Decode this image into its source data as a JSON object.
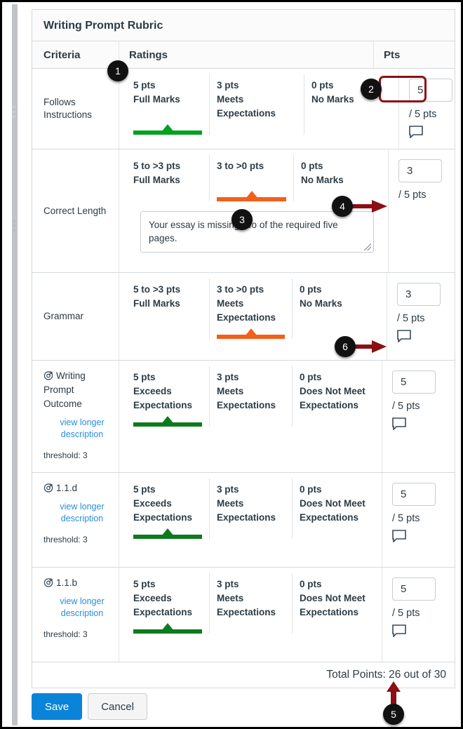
{
  "rubric": {
    "title": "Writing Prompt Rubric",
    "columns": {
      "criteria": "Criteria",
      "ratings": "Ratings",
      "pts": "Pts"
    },
    "rows": [
      {
        "criterion": "Follows Instructions",
        "is_outcome": false,
        "ratings": [
          {
            "pts": "5 pts",
            "desc": "Full Marks",
            "selected": true,
            "color": "#00A11F"
          },
          {
            "pts": "3 pts",
            "desc": "Meets Expectations",
            "selected": false
          },
          {
            "pts": "0 pts",
            "desc": "No Marks",
            "selected": false
          }
        ],
        "score": "5",
        "denominator": "/ 5 pts",
        "comment_icon": "comment-bubble-icon",
        "comment_text": null
      },
      {
        "criterion": "Correct Length",
        "is_outcome": false,
        "ratings": [
          {
            "pts": "5 to >3 pts",
            "desc": "Full Marks",
            "selected": false
          },
          {
            "pts": "3 to >0 pts",
            "desc": "",
            "selected": true,
            "color": "#F2601A"
          },
          {
            "pts": "0 pts",
            "desc": "No Marks",
            "selected": false
          }
        ],
        "score": "3",
        "denominator": "/ 5 pts",
        "comment_icon": null,
        "comment_text": "Your essay is missing two of the required five pages."
      },
      {
        "criterion": "Grammar",
        "is_outcome": false,
        "ratings": [
          {
            "pts": "5 to >3 pts",
            "desc": "Full Marks",
            "selected": false
          },
          {
            "pts": "3 to >0 pts",
            "desc": "Meets Expectations",
            "selected": true,
            "color": "#F2601A"
          },
          {
            "pts": "0 pts",
            "desc": "No Marks",
            "selected": false
          }
        ],
        "score": "3",
        "denominator": "/ 5 pts",
        "comment_icon": "comment-bubble-icon",
        "comment_text": null
      },
      {
        "criterion": "Writing Prompt Outcome",
        "is_outcome": true,
        "view_longer": "view longer description",
        "threshold": "threshold: 3",
        "ratings": [
          {
            "pts": "5 pts",
            "desc": "Exceeds Expectations",
            "selected": true,
            "color": "#0E7A1E"
          },
          {
            "pts": "3 pts",
            "desc": "Meets Expectations",
            "selected": false
          },
          {
            "pts": "0 pts",
            "desc": "Does Not Meet Expectations",
            "selected": false
          }
        ],
        "score": "5",
        "denominator": "/ 5 pts",
        "comment_icon": "comment-bubble-icon",
        "comment_text": null
      },
      {
        "criterion": "1.1.d",
        "is_outcome": true,
        "view_longer": "view longer description",
        "threshold": "threshold: 3",
        "ratings": [
          {
            "pts": "5 pts",
            "desc": "Exceeds Expectations",
            "selected": true,
            "color": "#0E7A1E"
          },
          {
            "pts": "3 pts",
            "desc": "Meets Expectations",
            "selected": false
          },
          {
            "pts": "0 pts",
            "desc": "Does Not Meet Expectations",
            "selected": false
          }
        ],
        "score": "5",
        "denominator": "/ 5 pts",
        "comment_icon": "comment-bubble-icon",
        "comment_text": null
      },
      {
        "criterion": "1.1.b",
        "is_outcome": true,
        "view_longer": "view longer description",
        "threshold": "threshold: 3",
        "ratings": [
          {
            "pts": "5 pts",
            "desc": "Exceeds Expectations",
            "selected": true,
            "color": "#0E7A1E"
          },
          {
            "pts": "3 pts",
            "desc": "Meets Expectations",
            "selected": false
          },
          {
            "pts": "0 pts",
            "desc": "Does Not Meet Expectations",
            "selected": false
          }
        ],
        "score": "5",
        "denominator": "/ 5 pts",
        "comment_icon": "comment-bubble-icon",
        "comment_text": null
      }
    ],
    "total_points": "Total Points: 26 out of 30"
  },
  "buttons": {
    "save": "Save",
    "cancel": "Cancel"
  },
  "annotations": [
    {
      "id": "1",
      "label": "1"
    },
    {
      "id": "2",
      "label": "2"
    },
    {
      "id": "3",
      "label": "3"
    },
    {
      "id": "4",
      "label": "4"
    },
    {
      "id": "5",
      "label": "5"
    },
    {
      "id": "6",
      "label": "6"
    }
  ],
  "colors": {
    "accent_blue": "#0A84D8",
    "link_blue": "#2B8DD9",
    "selected_green": "#00A11F",
    "selected_orange": "#F2601A",
    "annotation_red": "#8B1014",
    "text": "#2D3B45"
  }
}
